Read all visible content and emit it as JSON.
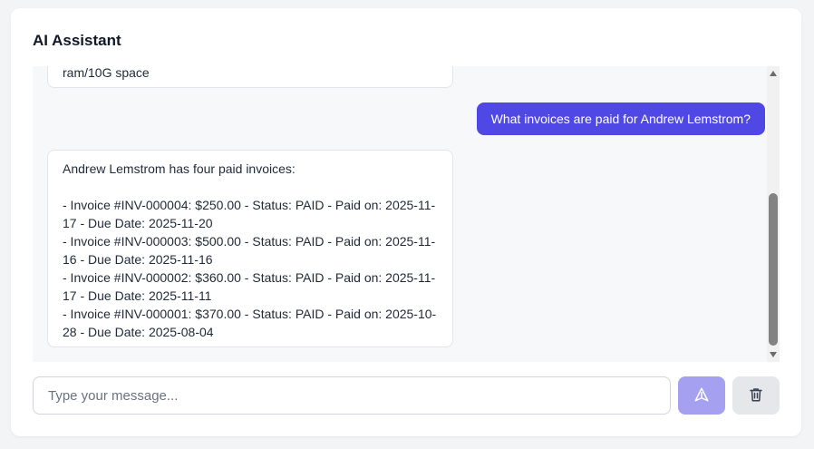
{
  "header": {
    "title": "AI Assistant"
  },
  "messages": {
    "partial_bot": {
      "text": "ram/10G space"
    },
    "user": {
      "text": "What invoices are paid for Andrew Lemstrom?"
    },
    "bot": {
      "intro": "Andrew Lemstrom has four paid invoices:",
      "lines": [
        "- Invoice #INV-000004: $250.00 - Status: PAID - Paid on: 2025-11-17 - Due Date: 2025-11-20",
        "- Invoice #INV-000003: $500.00 - Status: PAID - Paid on: 2025-11-16 - Due Date: 2025-11-16",
        "- Invoice #INV-000002: $360.00 - Status: PAID - Paid on: 2025-11-17 - Due Date: 2025-11-11",
        "- Invoice #INV-000001: $370.00 - Status: PAID - Paid on: 2025-10-28 - Due Date: 2025-08-04"
      ]
    }
  },
  "composer": {
    "placeholder": "Type your message...",
    "send_icon": "send-icon",
    "delete_icon": "trash-icon"
  },
  "colors": {
    "accent": "#5048e5",
    "send_disabled": "#a5a1f0",
    "delete_bg": "#e5e7eb"
  }
}
